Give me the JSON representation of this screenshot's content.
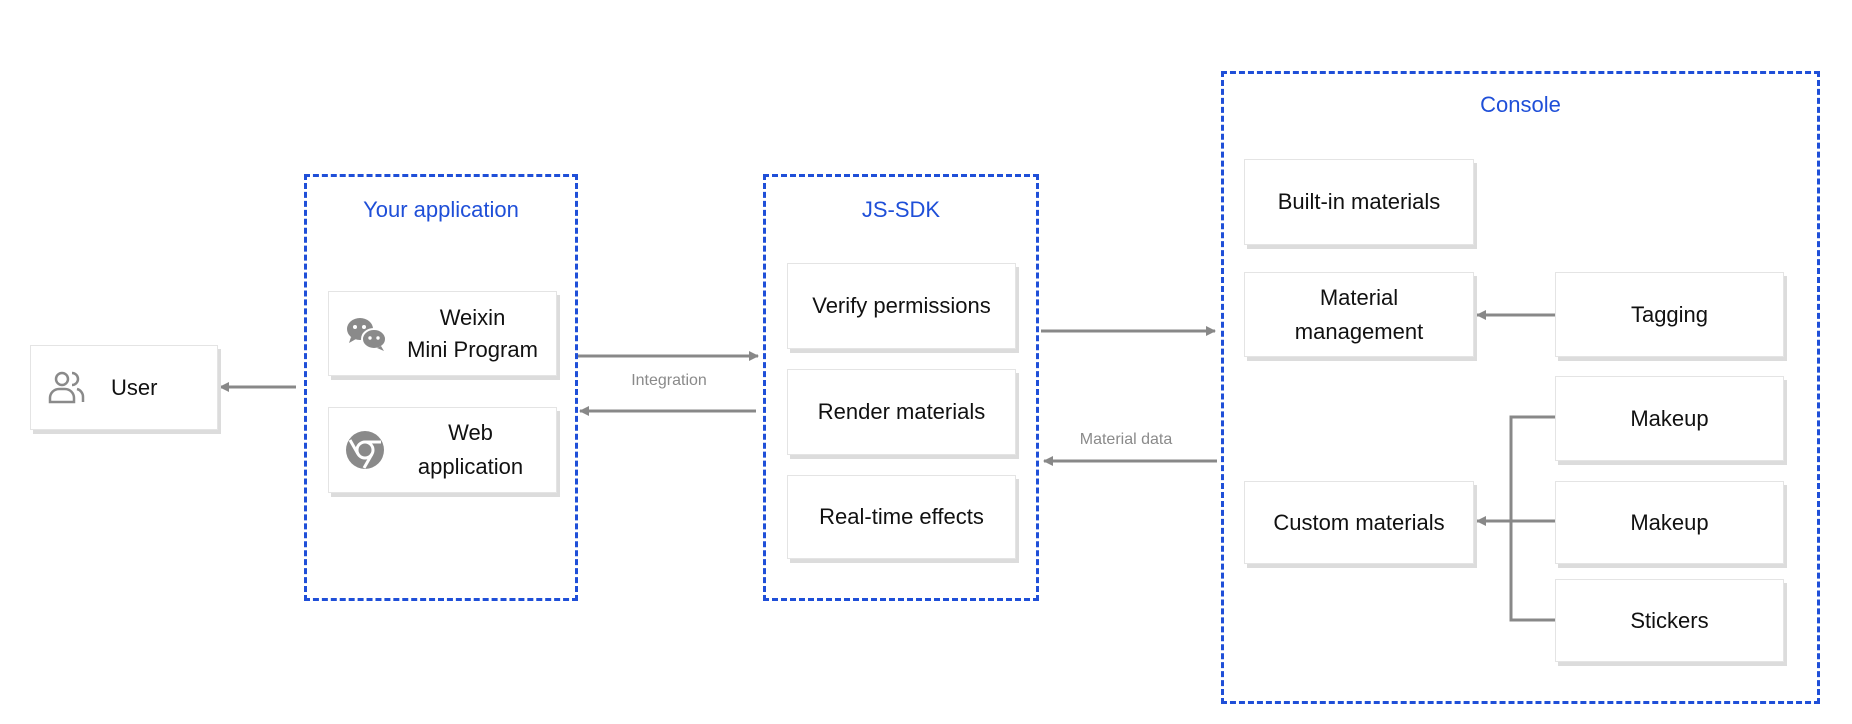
{
  "colors": {
    "group_border": "#1f4fd8",
    "arrow": "#888888",
    "icon": "#8a8a8a"
  },
  "groups": {
    "your_app": "Your application",
    "jssdk": "JS-SDK",
    "console": "Console"
  },
  "user": {
    "label": "User",
    "icon": "users-icon"
  },
  "your_app": {
    "weixin": [
      "Weixin",
      "Mini Program"
    ],
    "weixin_icon": "wechat-icon",
    "web": [
      "Web",
      "application"
    ],
    "web_icon": "chrome-icon"
  },
  "jssdk": {
    "items": [
      "Verify permissions",
      "Render materials",
      "Real-time effects"
    ]
  },
  "console": {
    "builtin": "Built-in materials",
    "management": [
      "Material",
      "management"
    ],
    "custom": "Custom materials",
    "tagging": "Tagging",
    "makeup1": "Makeup",
    "makeup2": "Makeup",
    "stickers": "Stickers"
  },
  "edges": {
    "integration": "Integration",
    "material_data": "Material data"
  }
}
